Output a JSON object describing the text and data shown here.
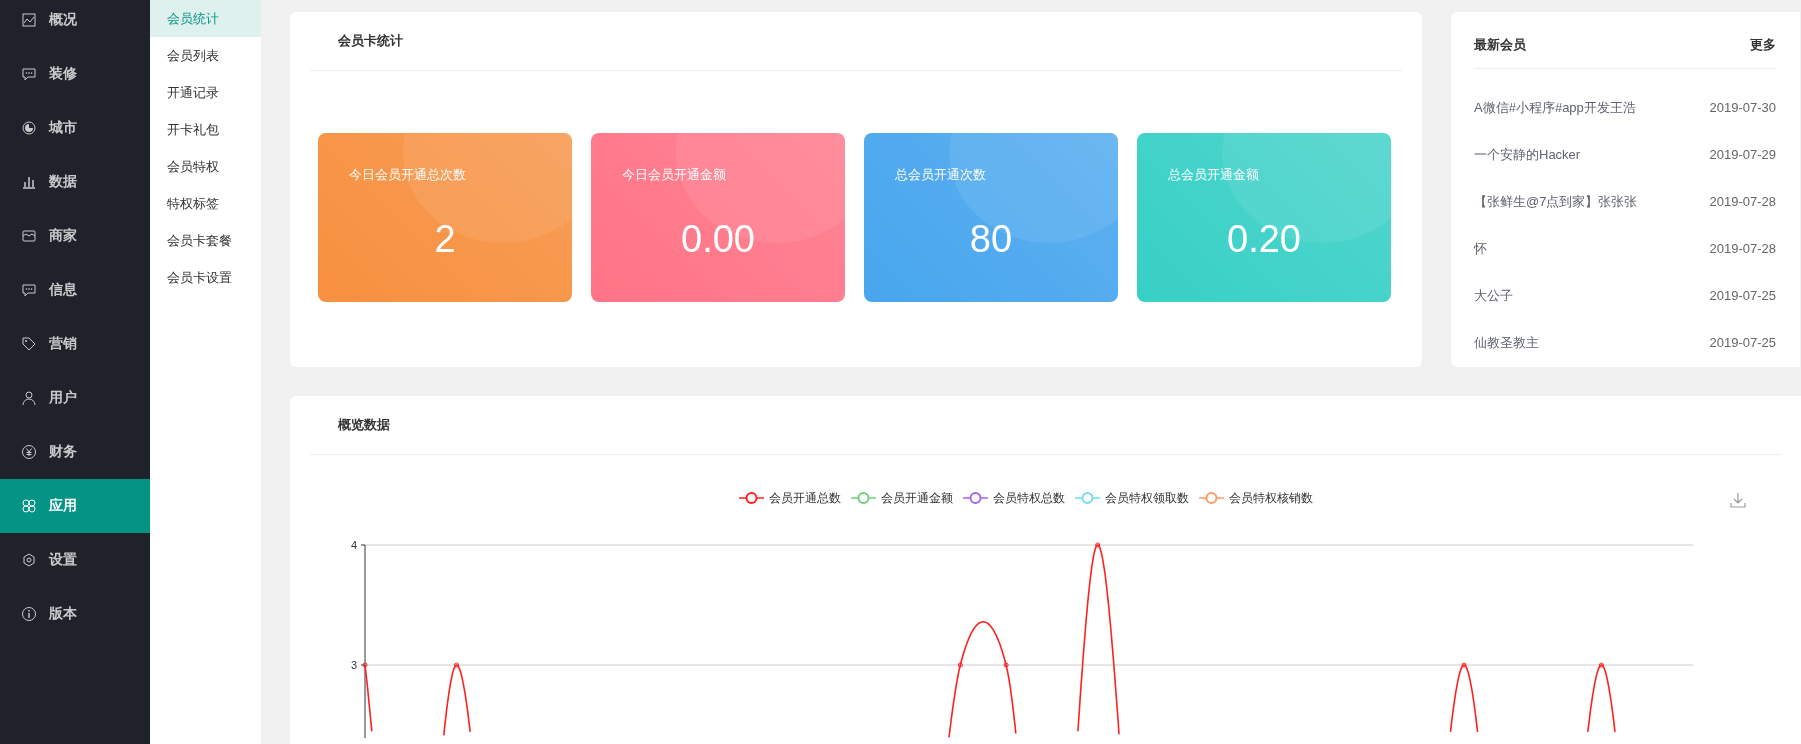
{
  "sidebar": {
    "items": [
      {
        "label": "概况",
        "selected": false
      },
      {
        "label": "装修",
        "selected": false
      },
      {
        "label": "城市",
        "selected": false
      },
      {
        "label": "数据",
        "selected": false
      },
      {
        "label": "商家",
        "selected": false
      },
      {
        "label": "信息",
        "selected": false
      },
      {
        "label": "营销",
        "selected": false
      },
      {
        "label": "用户",
        "selected": false
      },
      {
        "label": "财务",
        "selected": false
      },
      {
        "label": "应用",
        "selected": true
      },
      {
        "label": "设置",
        "selected": false
      },
      {
        "label": "版本",
        "selected": false
      }
    ]
  },
  "submenu": {
    "items": [
      {
        "label": "会员统计",
        "selected": true
      },
      {
        "label": "会员列表",
        "selected": false
      },
      {
        "label": "开通记录",
        "selected": false
      },
      {
        "label": "开卡礼包",
        "selected": false
      },
      {
        "label": "会员特权",
        "selected": false
      },
      {
        "label": "特权标签",
        "selected": false
      },
      {
        "label": "会员卡套餐",
        "selected": false
      },
      {
        "label": "会员卡设置",
        "selected": false
      }
    ]
  },
  "card_stats": {
    "title": "会员卡统计",
    "cards": [
      {
        "label": "今日会员开通总次数",
        "value": "2",
        "color": "#f7903f"
      },
      {
        "label": "今日会员开通金额",
        "value": "0.00",
        "color": "#ff7486"
      },
      {
        "label": "总会员开通次数",
        "value": "80",
        "color": "#48a6ee"
      },
      {
        "label": "总会员开通金额",
        "value": "0.20",
        "color": "#38d0c6"
      }
    ]
  },
  "latest_members": {
    "title": "最新会员",
    "more": "更多",
    "rows": [
      {
        "name": "A微信#小程序#app开发王浩",
        "date": "2019-07-30"
      },
      {
        "name": "一个安静的Hacker",
        "date": "2019-07-29"
      },
      {
        "name": "【张鲜生@7点到家】张张张",
        "date": "2019-07-28"
      },
      {
        "name": "怀",
        "date": "2019-07-28"
      },
      {
        "name": "大公子",
        "date": "2019-07-25"
      },
      {
        "name": "仙教圣教主",
        "date": "2019-07-25"
      }
    ]
  },
  "overview": {
    "title": "概览数据",
    "legend": [
      {
        "label": "会员开通总数",
        "color": "#ff2020"
      },
      {
        "label": "会员开通金额",
        "color": "#6fd17c"
      },
      {
        "label": "会员特权总数",
        "color": "#a466f2"
      },
      {
        "label": "会员特权领取数",
        "color": "#72dcf0"
      },
      {
        "label": "会员特权核销数",
        "color": "#ff9a66"
      }
    ],
    "y_tick_labels": [
      "4",
      "3"
    ]
  }
}
